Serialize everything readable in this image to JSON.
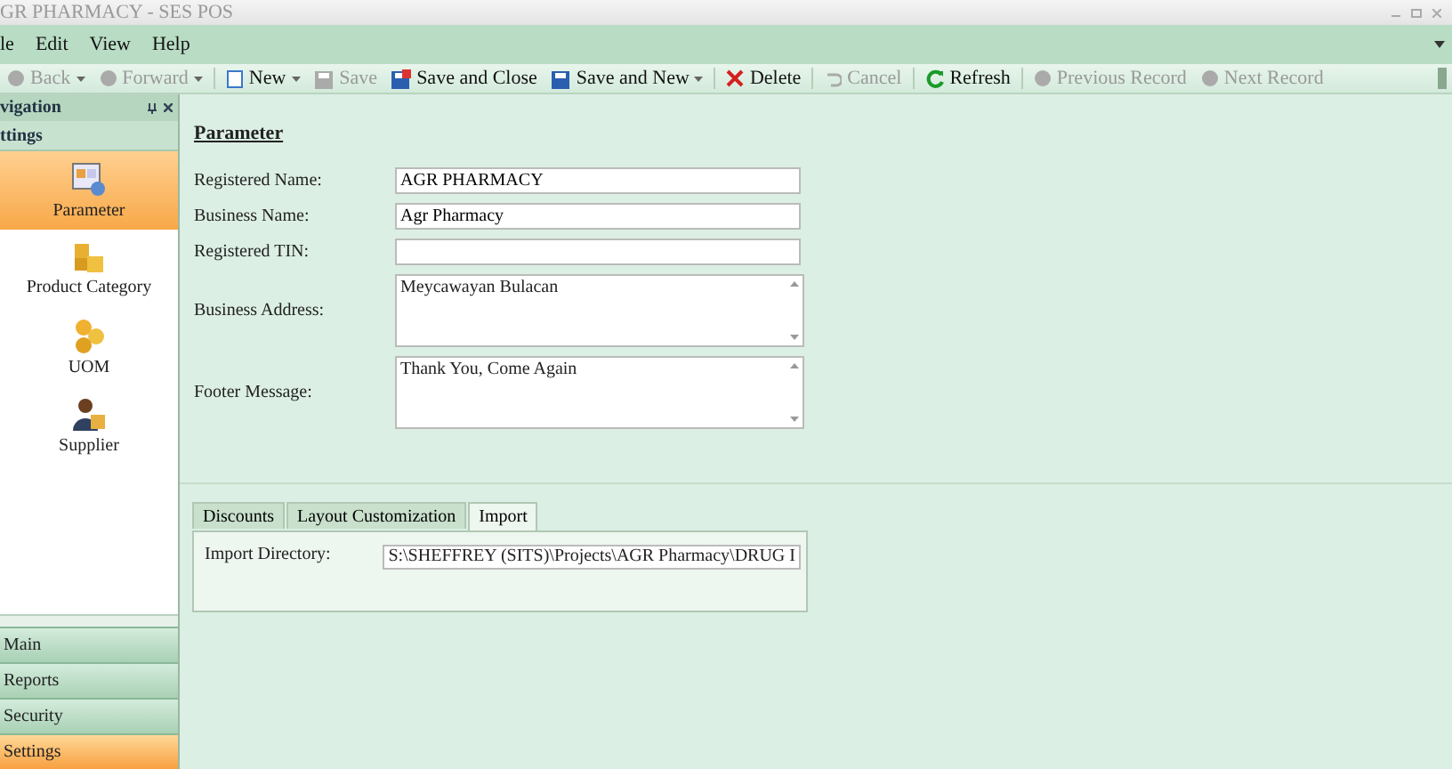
{
  "window": {
    "title": "GR PHARMACY - SES POS"
  },
  "menu": [
    "le",
    "Edit",
    "View",
    "Help"
  ],
  "toolbar": [
    {
      "label": "Back",
      "disabled": true,
      "dropdown": true
    },
    {
      "label": "Forward",
      "disabled": true,
      "dropdown": true
    },
    {
      "label": "New",
      "disabled": false,
      "dropdown": true
    },
    {
      "label": "Save",
      "disabled": true,
      "dropdown": false
    },
    {
      "label": "Save and Close",
      "disabled": false,
      "dropdown": false
    },
    {
      "label": "Save and New",
      "disabled": false,
      "dropdown": true
    },
    {
      "label": "Delete",
      "disabled": false,
      "dropdown": false
    },
    {
      "label": "Cancel",
      "disabled": true,
      "dropdown": false
    },
    {
      "label": "Refresh",
      "disabled": false,
      "dropdown": false
    },
    {
      "label": "Previous Record",
      "disabled": true,
      "dropdown": false
    },
    {
      "label": "Next Record",
      "disabled": true,
      "dropdown": false
    }
  ],
  "navigation": {
    "title": "vigation",
    "group": "ttings",
    "items": [
      {
        "label": "Parameter",
        "selected": true
      },
      {
        "label": "Product Category",
        "selected": false
      },
      {
        "label": "UOM",
        "selected": false
      },
      {
        "label": "Supplier",
        "selected": false
      }
    ],
    "groups": [
      {
        "label": "Main",
        "selected": false
      },
      {
        "label": "Reports",
        "selected": false
      },
      {
        "label": "Security",
        "selected": false
      },
      {
        "label": "Settings",
        "selected": true
      }
    ]
  },
  "form": {
    "heading": "Parameter",
    "fields": [
      {
        "label": "Registered Name:",
        "value": "AGR PHARMACY",
        "kind": "text"
      },
      {
        "label": "Business Name:",
        "value": "Agr Pharmacy",
        "kind": "text"
      },
      {
        "label": "Registered TIN:",
        "kind": "text"
      },
      {
        "label": "Business Address:",
        "value": "Meycawayan Bulacan",
        "kind": "memo"
      },
      {
        "label": "Footer Message:",
        "value": "Thank You, Come Again",
        "kind": "memo"
      }
    ]
  },
  "tabs": [
    {
      "label": "Discounts",
      "selected": false
    },
    {
      "label": "Layout Customization",
      "selected": false
    },
    {
      "label": "Import",
      "selected": true
    }
  ],
  "import": {
    "label": "Import Directory:",
    "value": "S:\\SHEFFREY (SITS)\\Projects\\AGR Pharmacy\\DRUG I"
  }
}
